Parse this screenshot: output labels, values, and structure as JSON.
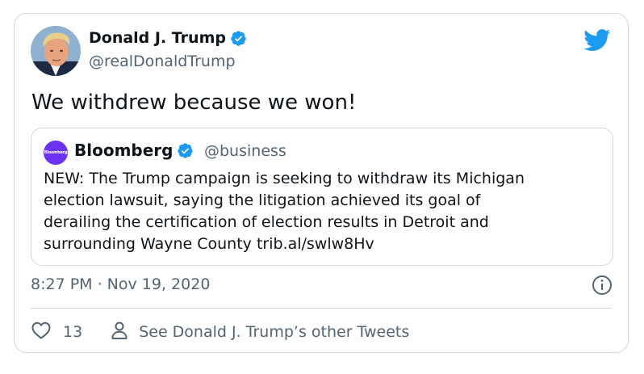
{
  "tweet": {
    "author_name": "Donald J. Trump",
    "author_handle": "@realDonaldTrump",
    "text": "We withdrew because we won!",
    "timestamp": "8:27 PM · Nov 19, 2020",
    "like_count": "13",
    "profile_link_label": "See Donald J. Trump’s other Tweets"
  },
  "quoted_tweet": {
    "author_name": "Bloomberg",
    "author_handle": "@business",
    "avatar_text": "Bloomberg",
    "text_lines": [
      "NEW: The Trump campaign is seeking to withdraw its Michigan",
      "election lawsuit, saying the litigation achieved its goal of",
      "derailing the certification of election results in Detroit and",
      "surrounding Wayne County trib.al/swlw8Hv"
    ]
  },
  "icons": {
    "verified": "verified-badge-icon",
    "brand": "twitter-bird-icon",
    "info": "info-icon",
    "like": "heart-icon",
    "person": "person-icon"
  },
  "colors": {
    "verified_blue": "#1d9bf0",
    "twitter_blue": "#1d9bf0",
    "bloomberg_purple": "#6d31f0",
    "secondary_text": "#536471",
    "border": "#cfd9de"
  }
}
